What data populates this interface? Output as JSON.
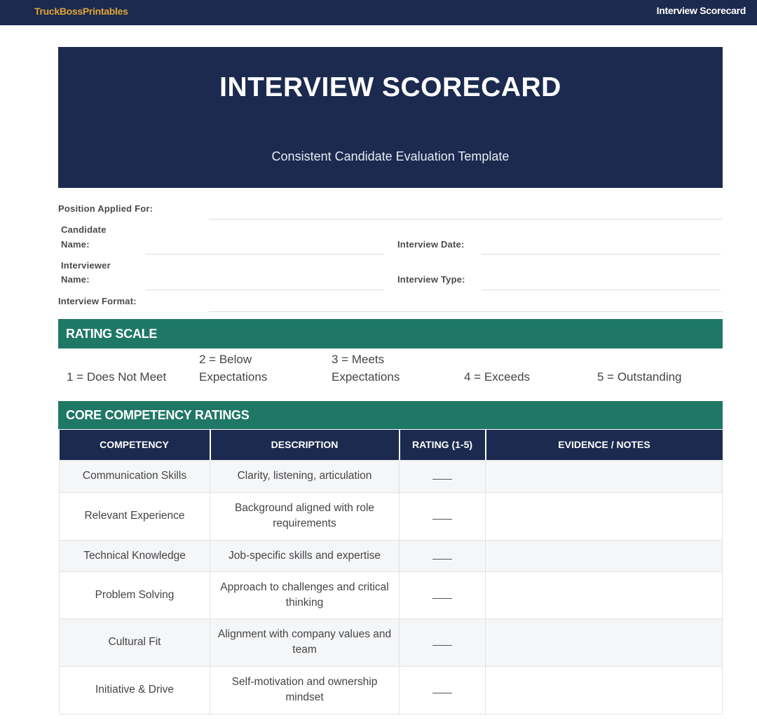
{
  "topbar": {
    "brand": "TruckBossPrintables",
    "title": "Interview Scorecard"
  },
  "header": {
    "title": "INTERVIEW SCORECARD",
    "subtitle": "Consistent Candidate Evaluation Template"
  },
  "fields": {
    "position": "Position Applied For:",
    "candidate_line1": "Candidate",
    "candidate_line2": "Name:",
    "interview_date": "Interview Date:",
    "interviewer_line1": "Interviewer",
    "interviewer_line2": "Name:",
    "interview_type": "Interview Type:",
    "interview_format": "Interview Format:"
  },
  "rating_scale": {
    "heading": "RATING SCALE",
    "items": [
      {
        "line1": "",
        "line2": "1 = Does Not Meet"
      },
      {
        "line1": "2 = Below",
        "line2": "Expectations"
      },
      {
        "line1": "3 = Meets",
        "line2": "Expectations"
      },
      {
        "line1": "",
        "line2": "4 = Exceeds"
      },
      {
        "line1": "",
        "line2": "5 = Outstanding"
      }
    ]
  },
  "competencies": {
    "heading": "CORE COMPETENCY RATINGS",
    "columns": [
      "COMPETENCY",
      "DESCRIPTION",
      "RATING (1-5)",
      "EVIDENCE / NOTES"
    ],
    "rows": [
      {
        "competency": "Communication Skills",
        "description": "Clarity, listening, articulation",
        "rating": "",
        "notes": ""
      },
      {
        "competency": "Relevant Experience",
        "description": "Background aligned with role requirements",
        "rating": "",
        "notes": ""
      },
      {
        "competency": "Technical Knowledge",
        "description": "Job-specific skills and expertise",
        "rating": "",
        "notes": ""
      },
      {
        "competency": "Problem Solving",
        "description": "Approach to challenges and critical thinking",
        "rating": "",
        "notes": ""
      },
      {
        "competency": "Cultural Fit",
        "description": "Alignment with company values and team",
        "rating": "",
        "notes": ""
      },
      {
        "competency": "Initiative & Drive",
        "description": "Self-motivation and ownership mindset",
        "rating": "",
        "notes": ""
      }
    ]
  }
}
